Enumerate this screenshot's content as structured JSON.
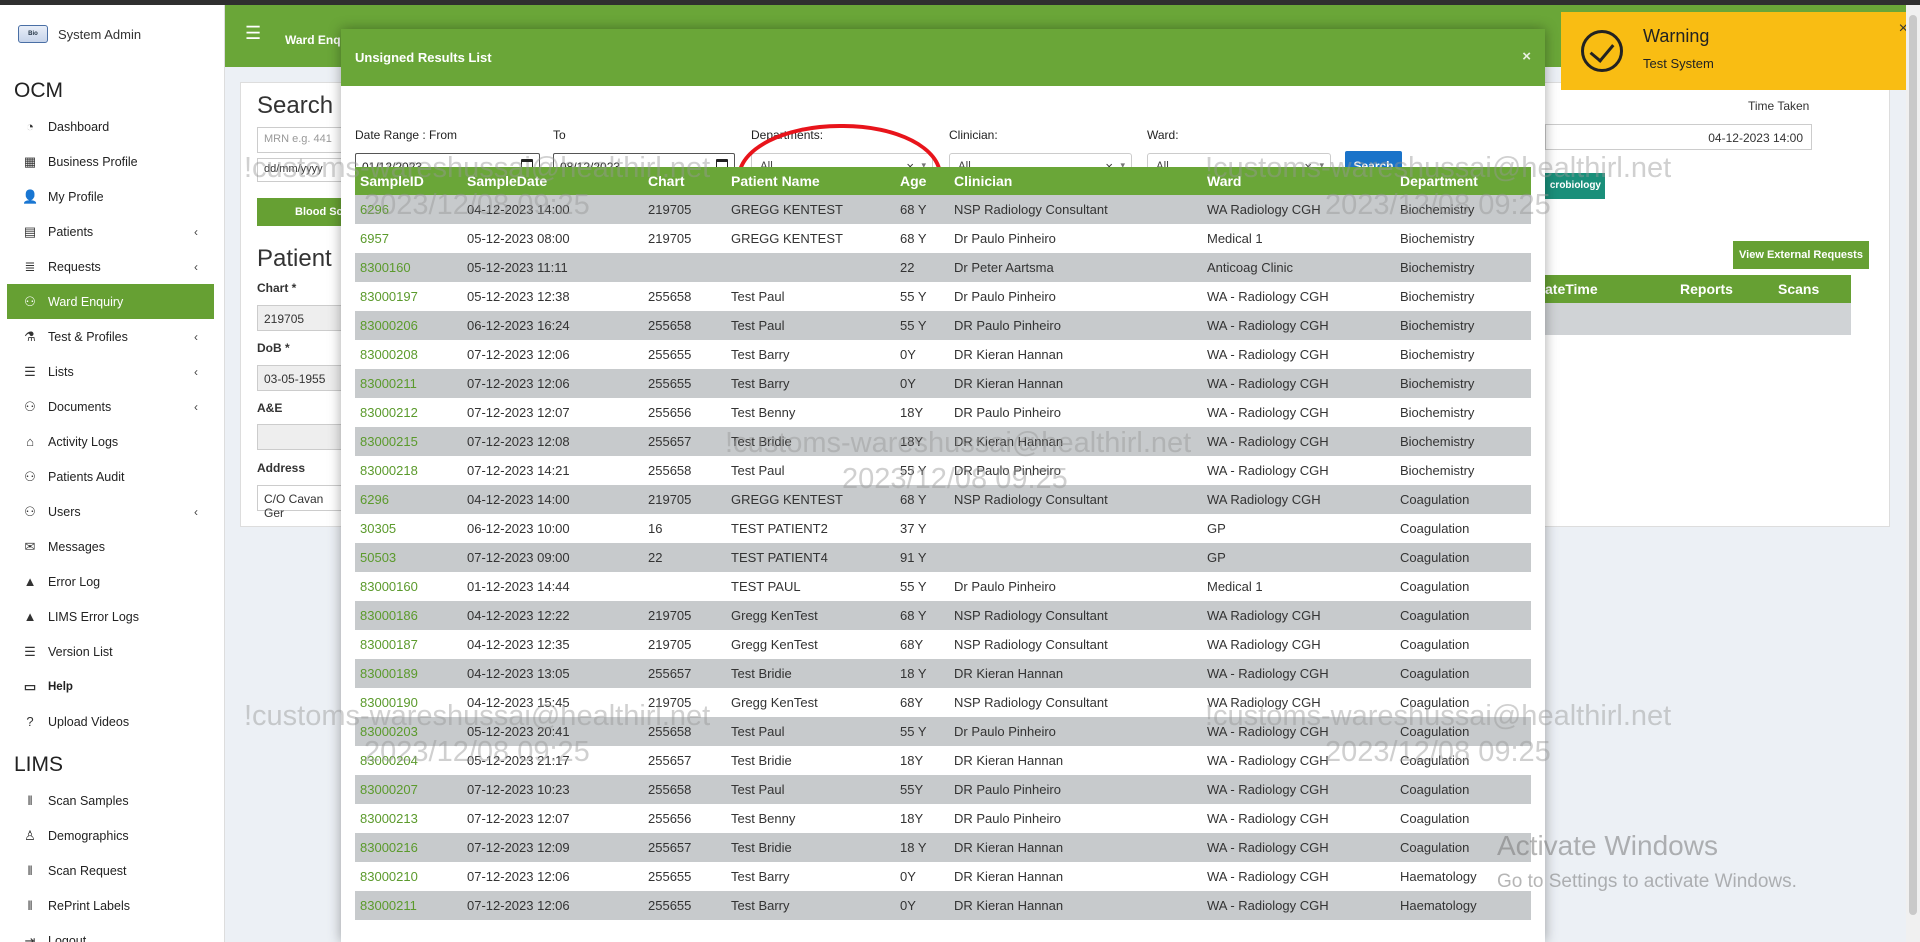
{
  "sidebar": {
    "brand_name": "System Admin",
    "logo_text": "Bio",
    "ocm_title": "OCM",
    "lims_title": "LIMS",
    "ocm_items": [
      {
        "label": "Dashboard",
        "icon": "dashboard-icon",
        "chevron": false
      },
      {
        "label": "Business Profile",
        "icon": "building-icon",
        "chevron": false
      },
      {
        "label": "My Profile",
        "icon": "user-icon",
        "chevron": false
      },
      {
        "label": "Patients",
        "icon": "id-card-icon",
        "chevron": true
      },
      {
        "label": "Requests",
        "icon": "database-icon",
        "chevron": true
      },
      {
        "label": "Ward Enquiry",
        "icon": "users-icon",
        "chevron": false,
        "active": true
      },
      {
        "label": "Test & Profiles",
        "icon": "flask-icon",
        "chevron": true
      },
      {
        "label": "Lists",
        "icon": "list-icon",
        "chevron": true
      },
      {
        "label": "Documents",
        "icon": "users-icon",
        "chevron": true
      },
      {
        "label": "Activity Logs",
        "icon": "bank-icon",
        "chevron": false
      },
      {
        "label": "Patients Audit",
        "icon": "users-icon",
        "chevron": false
      },
      {
        "label": "Users",
        "icon": "users-icon",
        "chevron": true
      },
      {
        "label": "Messages",
        "icon": "envelope-icon",
        "chevron": false
      },
      {
        "label": "Error Log",
        "icon": "warning-icon",
        "chevron": false
      },
      {
        "label": "LIMS Error Logs",
        "icon": "warning-icon",
        "chevron": false
      },
      {
        "label": "Version List",
        "icon": "list-icon",
        "chevron": false
      },
      {
        "label": "Help",
        "icon": "keyboard-icon",
        "chevron": false,
        "bold": true
      },
      {
        "label": "Upload Videos",
        "icon": "question-icon",
        "chevron": false
      }
    ],
    "lims_items": [
      {
        "label": "Scan Samples",
        "icon": "barcode-icon"
      },
      {
        "label": "Demographics",
        "icon": "person-icon"
      },
      {
        "label": "Scan Request",
        "icon": "barcode-icon"
      },
      {
        "label": "RePrint Labels",
        "icon": "barcode-icon"
      },
      {
        "label": "Logout",
        "icon": "logout-icon"
      }
    ]
  },
  "header": {
    "ward_tab": "Ward Enq"
  },
  "background": {
    "search_title": "Search",
    "mrn_placeholder": "MRN e.g. 441",
    "date_placeholder": "dd/mm/yyyy",
    "blood_button": "Blood Sc",
    "patient_title": "Patient",
    "chart_label": "Chart *",
    "chart_value": "219705",
    "dob_label": "DoB *",
    "dob_value": "03-05-1955",
    "ae_label": "A&E",
    "address_label": "Address",
    "address_value": "C/O Cavan Ger",
    "time_taken_label": "Time Taken",
    "time_taken_value": "04-12-2023 14:00",
    "micro_button": "crobiology",
    "external_button": "View External Requests",
    "table_headers": [
      "ateTime",
      "Reports",
      "Scans"
    ]
  },
  "modal": {
    "title": "Unsigned Results List",
    "close": "×",
    "filters": {
      "from_label": "Date Range : From",
      "from_value": "01/12/2023",
      "to_label": "To",
      "to_value": "08/12/2023",
      "departments_label": "Departments:",
      "departments_value": "All",
      "clinician_label": "Clinician:",
      "clinician_value": "All",
      "ward_label": "Ward:",
      "ward_value": "All",
      "clear_glyph": "×",
      "caret_glyph": "▾",
      "search_button": "Search"
    },
    "columns": [
      "SampleID",
      "SampleDate",
      "Chart",
      "Patient Name",
      "Age",
      "Clinician",
      "Ward",
      "Department"
    ],
    "rows": [
      [
        "6296",
        "04-12-2023 14:00",
        "219705",
        "GREGG KENTEST",
        "68 Y",
        "NSP Radiology Consultant",
        "WA Radiology CGH",
        "Biochemistry"
      ],
      [
        "6957",
        "05-12-2023 08:00",
        "219705",
        "GREGG KENTEST",
        "68 Y",
        "Dr Paulo Pinheiro",
        "Medical 1",
        "Biochemistry"
      ],
      [
        "8300160",
        "05-12-2023 11:11",
        "",
        "",
        "22",
        "Dr Peter Aartsma",
        "Anticoag Clinic",
        "Biochemistry"
      ],
      [
        "83000197",
        "05-12-2023 12:38",
        "255658",
        "Test Paul",
        "55 Y",
        "Dr Paulo Pinheiro",
        "WA - Radiology CGH",
        "Biochemistry"
      ],
      [
        "83000206",
        "06-12-2023 16:24",
        "255658",
        "Test Paul",
        "55 Y",
        "DR Paulo Pinheiro",
        "WA - Radiology CGH",
        "Biochemistry"
      ],
      [
        "83000208",
        "07-12-2023 12:06",
        "255655",
        "Test Barry",
        "0Y",
        "DR Kieran Hannan",
        "WA - Radiology CGH",
        "Biochemistry"
      ],
      [
        "83000211",
        "07-12-2023 12:06",
        "255655",
        "Test Barry",
        "0Y",
        "DR Kieran Hannan",
        "WA - Radiology CGH",
        "Biochemistry"
      ],
      [
        "83000212",
        "07-12-2023 12:07",
        "255656",
        "Test Benny",
        "18Y",
        "DR Paulo Pinheiro",
        "WA - Radiology CGH",
        "Biochemistry"
      ],
      [
        "83000215",
        "07-12-2023 12:08",
        "255657",
        "Test Bridie",
        "18Y",
        "DR Kieran Hannan",
        "WA - Radiology CGH",
        "Biochemistry"
      ],
      [
        "83000218",
        "07-12-2023 14:21",
        "255658",
        "Test Paul",
        "55 Y",
        "DR Paulo Pinheiro",
        "WA - Radiology CGH",
        "Biochemistry"
      ],
      [
        "6296",
        "04-12-2023 14:00",
        "219705",
        "GREGG KENTEST",
        "68 Y",
        "NSP Radiology Consultant",
        "WA Radiology CGH",
        "Coagulation"
      ],
      [
        "30305",
        "06-12-2023 10:00",
        "16",
        "TEST PATIENT2",
        "37 Y",
        "",
        "GP",
        "Coagulation"
      ],
      [
        "50503",
        "07-12-2023 09:00",
        "22",
        "TEST PATIENT4",
        "91 Y",
        "",
        "GP",
        "Coagulation"
      ],
      [
        "83000160",
        "01-12-2023 14:44",
        "",
        "TEST PAUL",
        "55 Y",
        "Dr Paulo Pinheiro",
        "Medical 1",
        "Coagulation"
      ],
      [
        "83000186",
        "04-12-2023 12:22",
        "219705",
        "Gregg KenTest",
        "68 Y",
        "NSP Radiology Consultant",
        "WA Radiology CGH",
        "Coagulation"
      ],
      [
        "83000187",
        "04-12-2023 12:35",
        "219705",
        "Gregg KenTest",
        "68Y",
        "NSP Radiology Consultant",
        "WA Radiology CGH",
        "Coagulation"
      ],
      [
        "83000189",
        "04-12-2023 13:05",
        "255657",
        "Test Bridie",
        "18 Y",
        "DR Kieran Hannan",
        "WA - Radiology CGH",
        "Coagulation"
      ],
      [
        "83000190",
        "04-12-2023 15:45",
        "219705",
        "Gregg KenTest",
        "68Y",
        "NSP Radiology Consultant",
        "WA Radiology CGH",
        "Coagulation"
      ],
      [
        "83000203",
        "05-12-2023 20:41",
        "255658",
        "Test Paul",
        "55 Y",
        "Dr Paulo Pinheiro",
        "WA - Radiology CGH",
        "Coagulation"
      ],
      [
        "83000204",
        "05-12-2023 21:17",
        "255657",
        "Test Bridie",
        "18Y",
        "DR Kieran Hannan",
        "WA - Radiology CGH",
        "Coagulation"
      ],
      [
        "83000207",
        "07-12-2023 10:23",
        "255658",
        "Test Paul",
        "55Y",
        "DR Paulo Pinheiro",
        "WA - Radiology CGH",
        "Coagulation"
      ],
      [
        "83000213",
        "07-12-2023 12:07",
        "255656",
        "Test Benny",
        "18Y",
        "DR Paulo Pinheiro",
        "WA - Radiology CGH",
        "Coagulation"
      ],
      [
        "83000216",
        "07-12-2023 12:09",
        "255657",
        "Test Bridie",
        "18 Y",
        "DR Kieran Hannan",
        "WA - Radiology CGH",
        "Coagulation"
      ],
      [
        "83000210",
        "07-12-2023 12:06",
        "255655",
        "Test Barry",
        "0Y",
        "DR Kieran Hannan",
        "WA - Radiology CGH",
        "Haematology"
      ],
      [
        "83000211",
        "07-12-2023 12:06",
        "255655",
        "Test Barry",
        "0Y",
        "DR Kieran Hannan",
        "WA - Radiology CGH",
        "Haematology"
      ]
    ]
  },
  "toast": {
    "title": "Warning",
    "message": "Test System",
    "close": "×"
  },
  "watermark": {
    "email": "!customs-wareshussai@healthirl.net",
    "timestamp": "2023/12/08 09:25",
    "activate_title": "Activate Windows",
    "activate_sub": "Go to Settings to activate Windows."
  },
  "colors": {
    "brand_green": "#6aa638",
    "search_blue": "#1a73c9",
    "warning_yellow": "#f9bd13",
    "annotation_red": "#e8141b"
  }
}
